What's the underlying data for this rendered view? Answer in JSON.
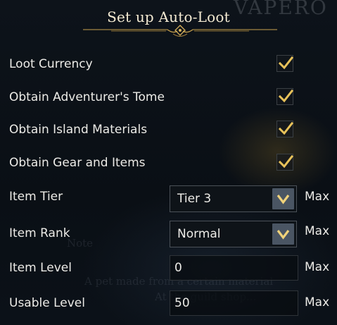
{
  "dialog": {
    "title": "Set up Auto-Loot"
  },
  "checkboxes": [
    {
      "label": "Loot Currency",
      "checked": true
    },
    {
      "label": "Obtain Adventurer's Tome",
      "checked": true
    },
    {
      "label": "Obtain Island Materials",
      "checked": true
    },
    {
      "label": "Obtain Gear and Items",
      "checked": true
    }
  ],
  "item_tier": {
    "label": "Item Tier",
    "value": "Tier 3",
    "suffix": "Max"
  },
  "item_rank": {
    "label": "Item Rank",
    "value": "Normal",
    "suffix": "Max"
  },
  "item_level": {
    "label": "Item Level",
    "value": "0",
    "suffix": "Max"
  },
  "usable_level": {
    "label": "Usable Level",
    "value": "50",
    "suffix": "Max"
  },
  "colors": {
    "checkmark": "#e8c25a",
    "ornament": "#c9a24e",
    "dropdown_button": "#4a5563"
  },
  "icons": {
    "checkbox_mark": "checkmark-icon",
    "dropdown": "chevron-down-icon",
    "title_ornament": "ornament-divider"
  }
}
